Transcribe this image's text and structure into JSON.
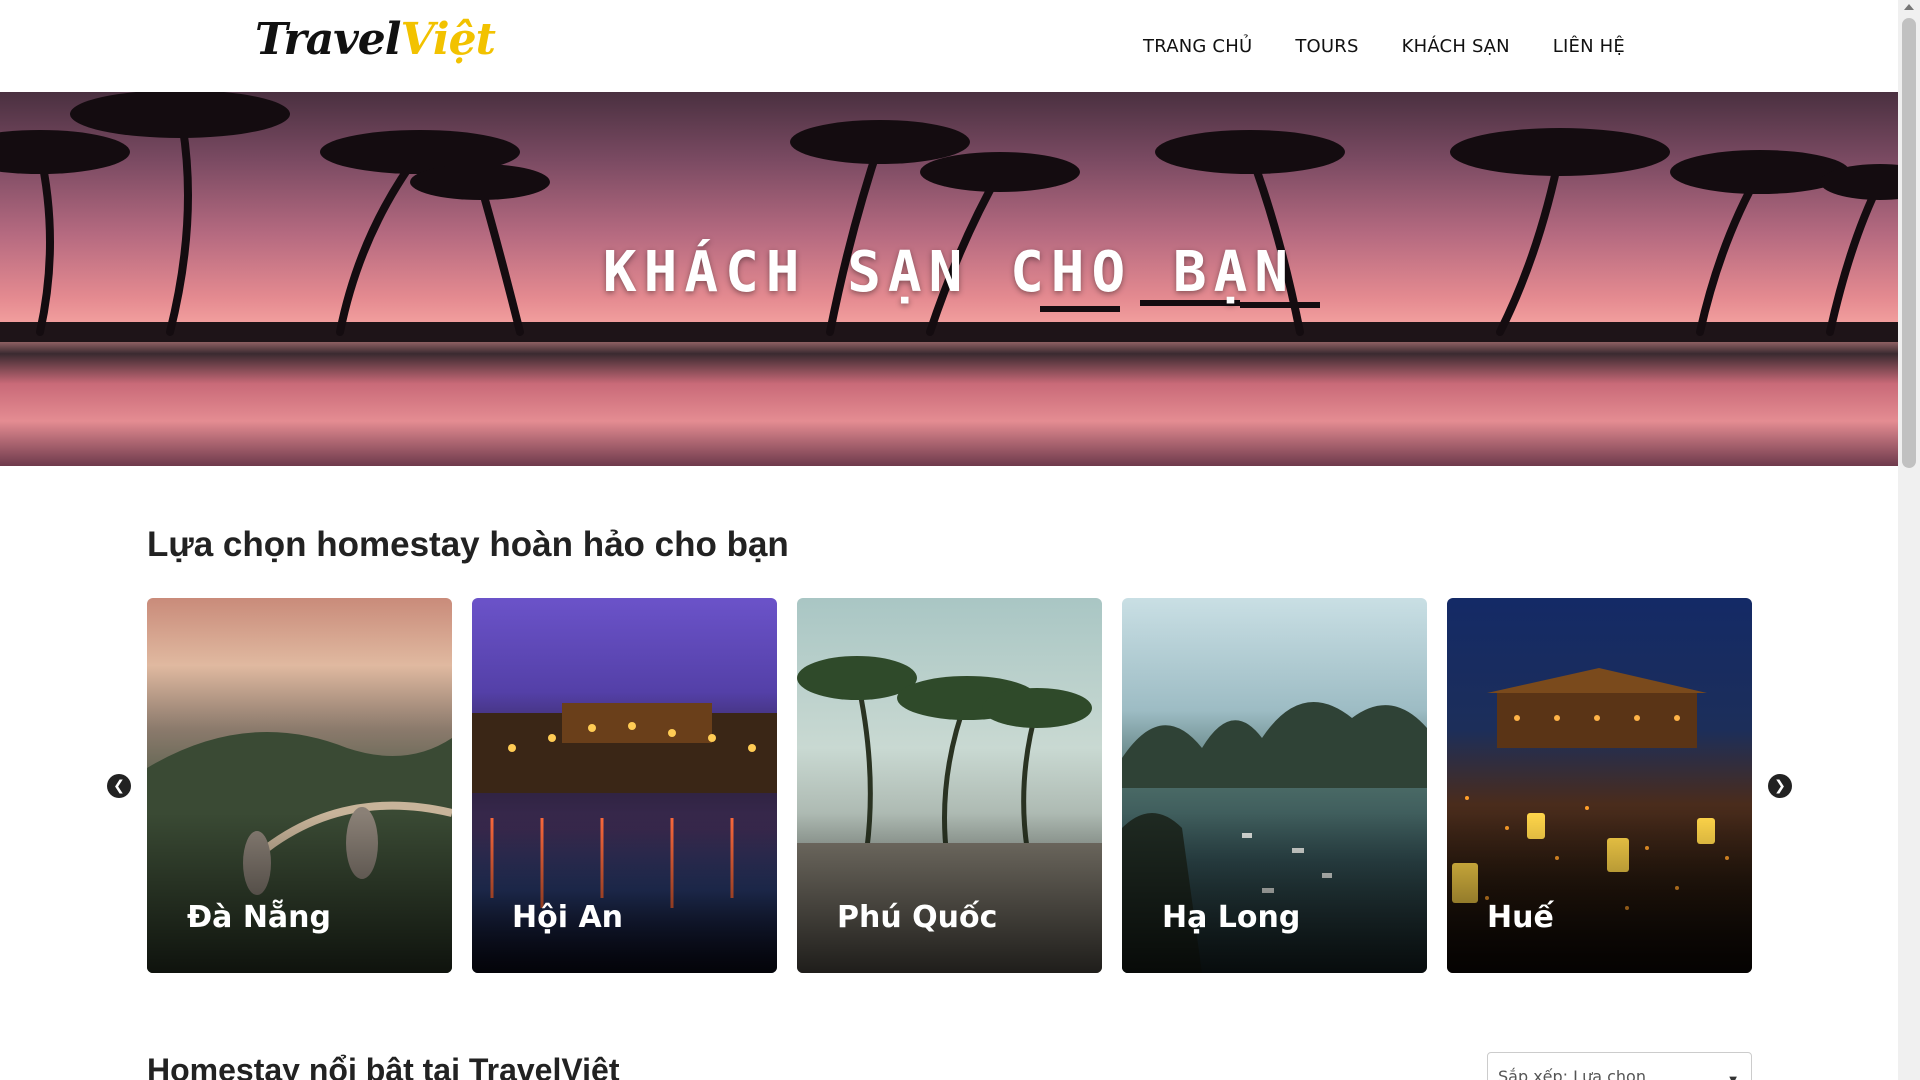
{
  "header": {
    "logo_part1": "Travel",
    "logo_part2": "Việt",
    "nav": [
      "TRANG CHỦ",
      "TOURS",
      "KHÁCH SẠN",
      "LIÊN HỆ"
    ]
  },
  "hero": {
    "title": "KHÁCH SẠN CHO BẠN"
  },
  "section": {
    "title": "Lựa chọn homestay hoàn hảo cho bạn",
    "prev_icon": "chevron-left-icon",
    "next_icon": "chevron-right-icon",
    "cards": [
      {
        "name": "Đà Nẵng"
      },
      {
        "name": "Hội An"
      },
      {
        "name": "Phú Quốc"
      },
      {
        "name": "Hạ Long"
      },
      {
        "name": "Huế"
      }
    ]
  },
  "section2": {
    "title": "Homestay nổi bật tại TravelViệt",
    "sort_label": "Sắp xếp:",
    "sort_value": "Lựa chọn"
  },
  "colors": {
    "logo_accent": "#f2c200",
    "text_dark": "#222222"
  }
}
